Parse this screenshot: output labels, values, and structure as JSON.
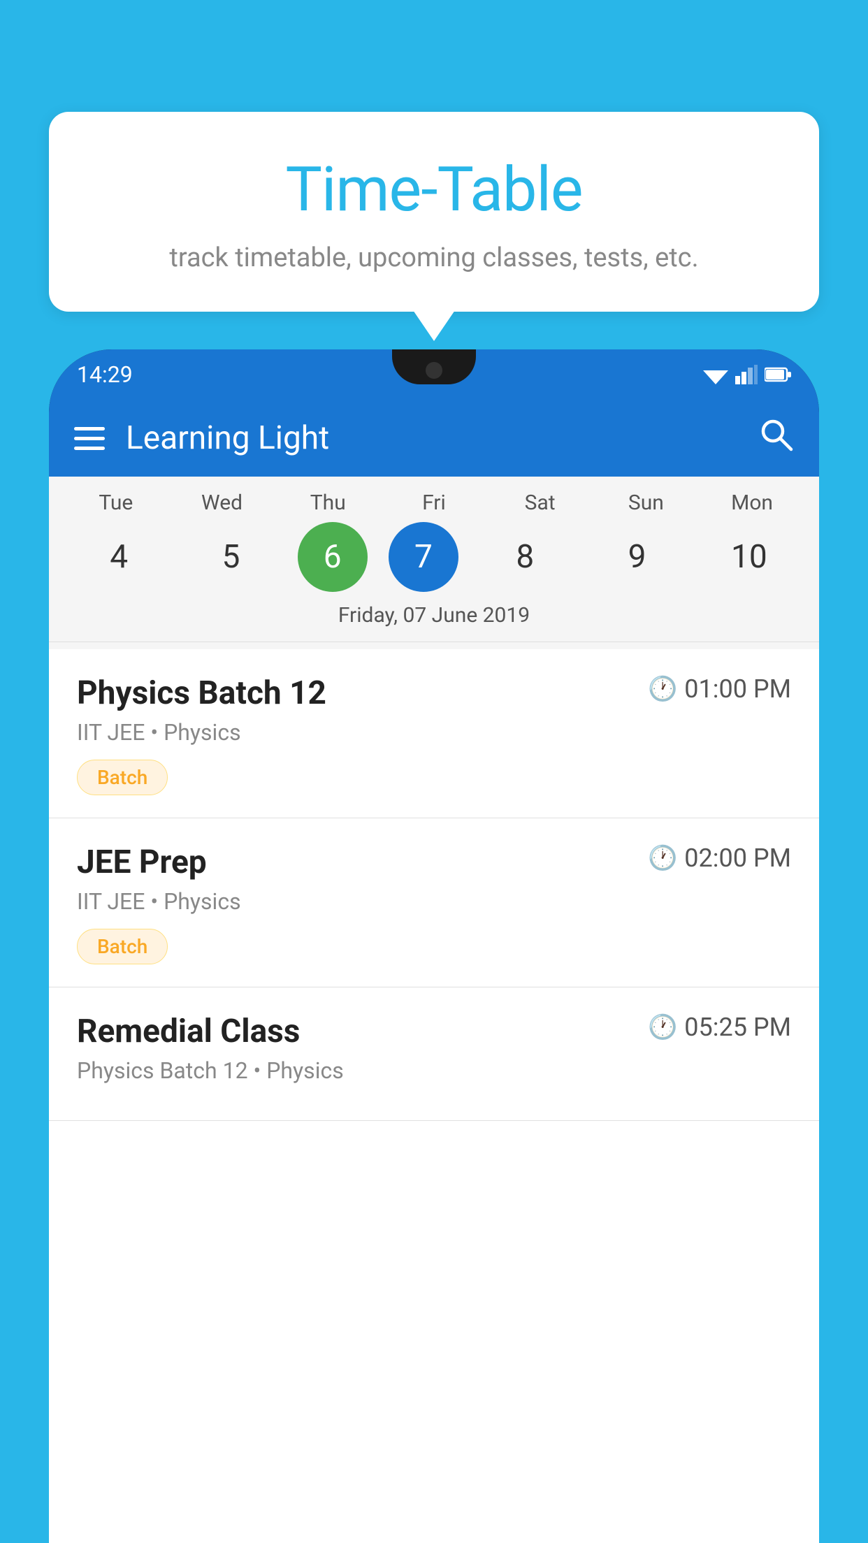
{
  "background_color": "#29b6e8",
  "tooltip": {
    "title": "Time-Table",
    "subtitle": "track timetable, upcoming classes, tests, etc."
  },
  "phone": {
    "status_bar": {
      "time": "14:29"
    },
    "app_bar": {
      "title": "Learning Light",
      "menu_icon": "hamburger-icon",
      "search_icon": "search-icon"
    },
    "calendar": {
      "days": [
        {
          "label": "Tue",
          "number": "4"
        },
        {
          "label": "Wed",
          "number": "5"
        },
        {
          "label": "Thu",
          "number": "6",
          "state": "today"
        },
        {
          "label": "Fri",
          "number": "7",
          "state": "selected"
        },
        {
          "label": "Sat",
          "number": "8"
        },
        {
          "label": "Sun",
          "number": "9"
        },
        {
          "label": "Mon",
          "number": "10"
        }
      ],
      "selected_date": "Friday, 07 June 2019"
    },
    "schedule": [
      {
        "title": "Physics Batch 12",
        "time": "01:00 PM",
        "subtitle": "IIT JEE • Physics",
        "badge": "Batch"
      },
      {
        "title": "JEE Prep",
        "time": "02:00 PM",
        "subtitle": "IIT JEE • Physics",
        "badge": "Batch"
      },
      {
        "title": "Remedial Class",
        "time": "05:25 PM",
        "subtitle": "Physics Batch 12 • Physics",
        "badge": null
      }
    ]
  }
}
